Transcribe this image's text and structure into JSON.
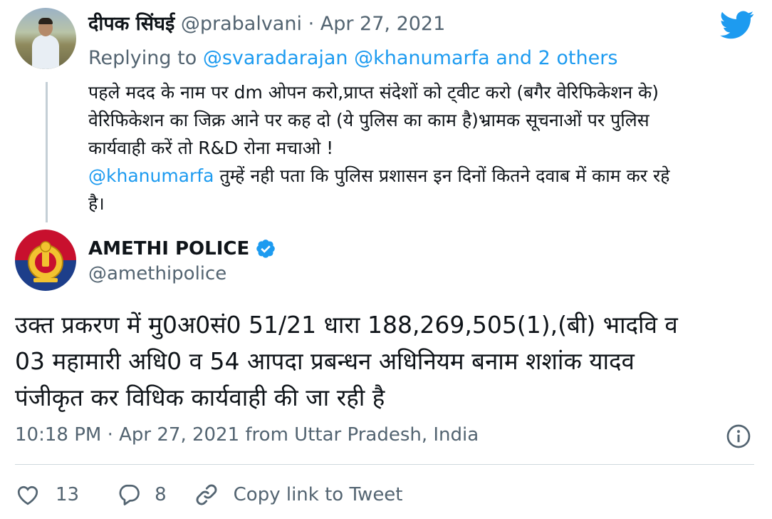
{
  "parent_tweet": {
    "author_name": "दीपक सिंघई",
    "handle": "@prabalvani",
    "separator": "·",
    "date": "Apr 27, 2021",
    "replying_prefix": "Replying to",
    "replying_to_1": "@svaradarajan",
    "replying_to_2": "@khanumarfa",
    "replying_suffix": "and 2 others",
    "text_line_1": "पहले मदद के नाम पर dm ओपन करो,प्राप्त संदेशों को ट्वीट करो (बगैर वेरिफिकेशन के)",
    "text_line_2": "वेरिफिकेशन का जिक्र आने पर कह दो (ये पुलिस का काम है)भ्रामक सूचनाओं पर पुलिस",
    "text_line_3": "कार्यवाही करें तो R&D रोना मचाओ !",
    "mention": "@khanumarfa",
    "text_line_4": " तुम्हें नही पता कि पुलिस प्रशासन इन दिनों कितने दवाब में काम कर रहे",
    "text_line_5": "है।"
  },
  "main_tweet": {
    "author_name": "AMETHI POLICE",
    "handle": "@amethipolice",
    "text_line_1": "उक्त प्रकरण में मु0अ0सं0 51/21 धारा 188,269,505(1),(बी) भादवि व",
    "text_line_2": "03 महामारी अधि0 व 54 आपदा प्रबन्धन अधिनियम बनाम शशांक यादव",
    "text_line_3": "पंजीकृत कर विधिक कार्यवाही की जा रही है",
    "time": "10:18 PM",
    "separator": "·",
    "date": "Apr 27, 2021",
    "source": "from Uttar Pradesh, India"
  },
  "actions": {
    "likes": "13",
    "replies": "8",
    "copy_link_label": "Copy link to Tweet"
  },
  "icons": {
    "logo": "twitter-bird-icon",
    "verified": "verified-badge-icon",
    "info": "info-icon",
    "like": "heart-icon",
    "reply": "reply-bubble-icon",
    "copy_link": "link-icon"
  },
  "colors": {
    "brand": "#1d9bf0",
    "text": "#0f1419",
    "muted": "#536471",
    "divider": "#cfd9de"
  }
}
